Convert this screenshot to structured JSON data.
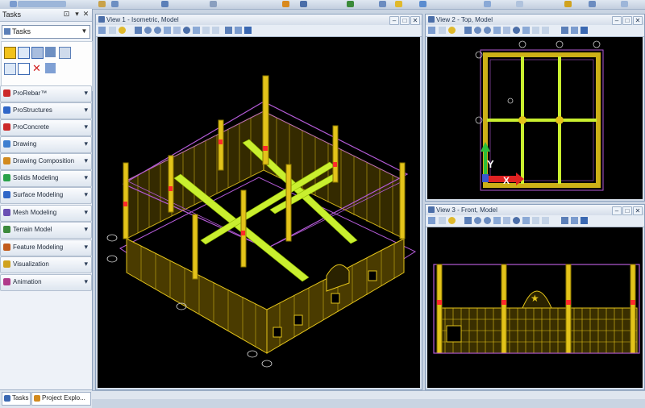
{
  "task_panel": {
    "title": "Tasks",
    "combo_value": "Tasks",
    "items": [
      {
        "label": "ProRebar™",
        "icon_color": "#cc2a2a"
      },
      {
        "label": "ProStructures",
        "icon_color": "#2f66c8"
      },
      {
        "label": "ProConcrete",
        "icon_color": "#cc2a2a"
      },
      {
        "label": "Drawing",
        "icon_color": "#3f7fd0"
      },
      {
        "label": "Drawing Composition",
        "icon_color": "#d28a1e"
      },
      {
        "label": "Solids Modeling",
        "icon_color": "#2aa24a"
      },
      {
        "label": "Surface Modeling",
        "icon_color": "#2f66c8"
      },
      {
        "label": "Mesh Modeling",
        "icon_color": "#6a4fb3"
      },
      {
        "label": "Terrain Model",
        "icon_color": "#3c8a3c"
      },
      {
        "label": "Feature Modeling",
        "icon_color": "#c25b1c"
      },
      {
        "label": "Visualization",
        "icon_color": "#d0a21e"
      },
      {
        "label": "Animation",
        "icon_color": "#b03a8a"
      }
    ],
    "tabs": [
      "Tasks",
      "Project Explo..."
    ]
  },
  "views": {
    "view1": {
      "title": "View 1 - Isometric, Model"
    },
    "view2": {
      "title": "View 2 - Top, Model",
      "axis_y": "Y",
      "axis_x": "X"
    },
    "view3": {
      "title": "View 3 - Front, Model"
    }
  },
  "colors": {
    "structure": "#e3c31a",
    "beam": "#c9ef2f",
    "outline": "#b35ad6",
    "accent_red": "#ff2a2a",
    "canvas": "#000000",
    "axis_green": "#2cbf3a",
    "axis_red": "#e02222"
  }
}
